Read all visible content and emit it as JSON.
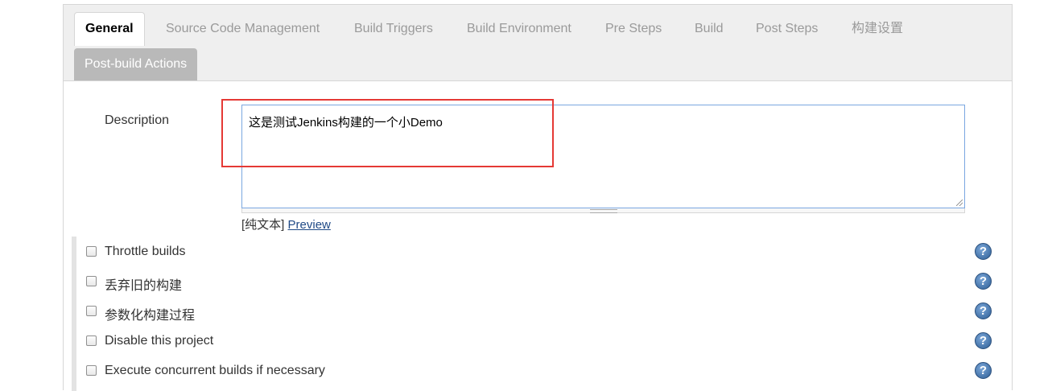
{
  "tabs": {
    "general": "General",
    "scm": "Source Code Management",
    "triggers": "Build Triggers",
    "environment": "Build Environment",
    "pre_steps": "Pre Steps",
    "build": "Build",
    "post_steps": "Post Steps",
    "build_settings": "构建设置",
    "post_build": "Post-build Actions"
  },
  "description": {
    "label": "Description",
    "value": "这是测试Jenkins构建的一个小Demo",
    "mode_plain": "[纯文本]",
    "preview_link": "Preview"
  },
  "options": [
    {
      "label": "Throttle builds",
      "checked": false
    },
    {
      "label": "丢弃旧的构建",
      "checked": false
    },
    {
      "label": "参数化构建过程",
      "checked": false
    },
    {
      "label": "Disable this project",
      "checked": false
    },
    {
      "label": "Execute concurrent builds if necessary",
      "checked": false
    }
  ],
  "help_glyph": "?",
  "colors": {
    "accent_link": "#204a87",
    "highlight": "#e53935",
    "help_icon": "#2f5f96"
  }
}
